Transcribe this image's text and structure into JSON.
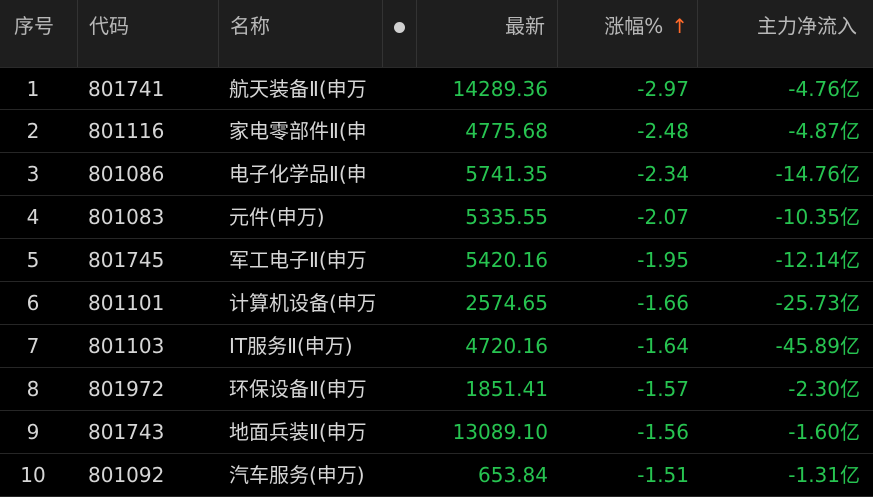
{
  "header": {
    "index_label": "序号",
    "code_label": "代码",
    "name_label": "名称",
    "latest_label": "最新",
    "change_label": "涨幅%",
    "sort_arrow": "↑",
    "flow_label": "主力净流入"
  },
  "colors": {
    "background": "#000000",
    "header_background": "#1e1e1e",
    "down_green": "#27c451",
    "sort_arrow": "#ff6a2a",
    "text": "#d6d6d6"
  },
  "rows": [
    {
      "index": "1",
      "code": "801741",
      "name": "航天装备Ⅱ(申万",
      "latest": "14289.36",
      "change": "-2.97",
      "flow": "-4.76亿"
    },
    {
      "index": "2",
      "code": "801116",
      "name": "家电零部件Ⅱ(申",
      "latest": "4775.68",
      "change": "-2.48",
      "flow": "-4.87亿"
    },
    {
      "index": "3",
      "code": "801086",
      "name": "电子化学品Ⅱ(申",
      "latest": "5741.35",
      "change": "-2.34",
      "flow": "-14.76亿"
    },
    {
      "index": "4",
      "code": "801083",
      "name": "元件(申万)",
      "latest": "5335.55",
      "change": "-2.07",
      "flow": "-10.35亿"
    },
    {
      "index": "5",
      "code": "801745",
      "name": "军工电子Ⅱ(申万",
      "latest": "5420.16",
      "change": "-1.95",
      "flow": "-12.14亿"
    },
    {
      "index": "6",
      "code": "801101",
      "name": "计算机设备(申万",
      "latest": "2574.65",
      "change": "-1.66",
      "flow": "-25.73亿"
    },
    {
      "index": "7",
      "code": "801103",
      "name": "IT服务Ⅱ(申万)",
      "latest": "4720.16",
      "change": "-1.64",
      "flow": "-45.89亿"
    },
    {
      "index": "8",
      "code": "801972",
      "name": "环保设备Ⅱ(申万",
      "latest": "1851.41",
      "change": "-1.57",
      "flow": "-2.30亿"
    },
    {
      "index": "9",
      "code": "801743",
      "name": "地面兵装Ⅱ(申万",
      "latest": "13089.10",
      "change": "-1.56",
      "flow": "-1.60亿"
    },
    {
      "index": "10",
      "code": "801092",
      "name": "汽车服务(申万)",
      "latest": "653.84",
      "change": "-1.51",
      "flow": "-1.31亿"
    }
  ]
}
